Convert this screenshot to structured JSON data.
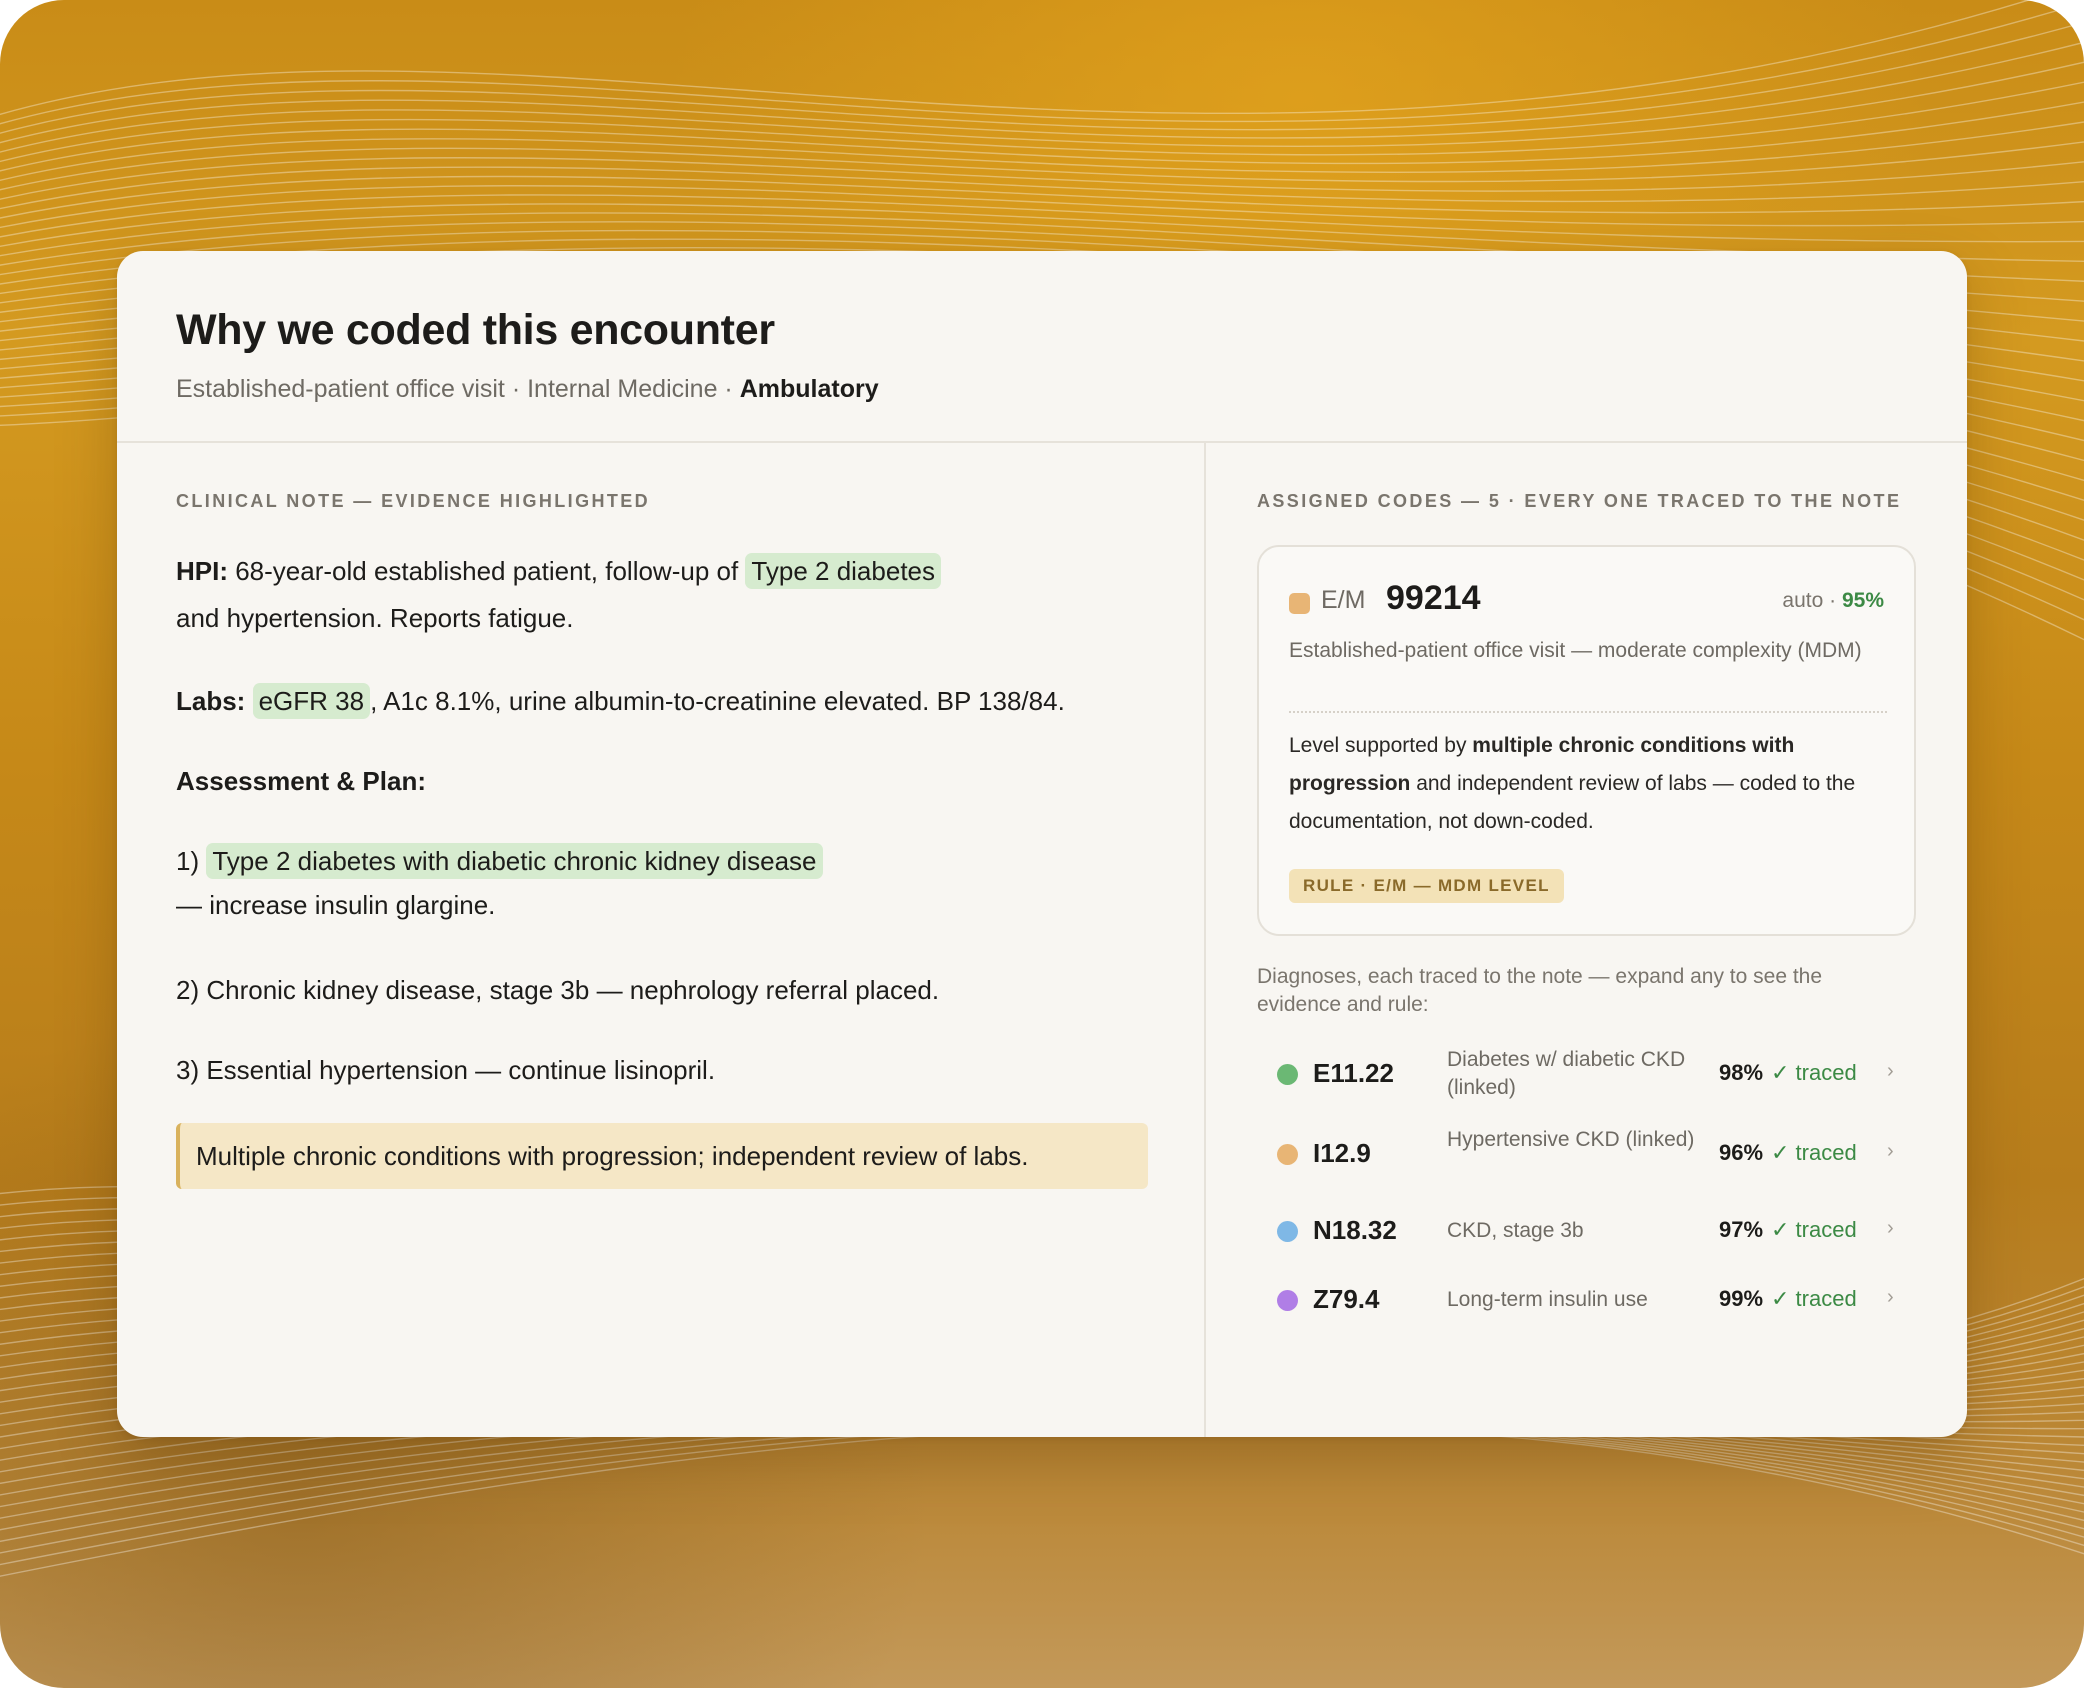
{
  "header": {
    "title": "Why we coded this encounter",
    "subtitle_prefix": "Established-patient office visit · Internal Medicine · ",
    "subtitle_bold": "Ambulatory"
  },
  "note": {
    "section_label": "CLINICAL NOTE — EVIDENCE HIGHLIGHTED",
    "hpi_label": "HPI:",
    "hpi_text": " 68-year-old established patient, follow-up of ",
    "hpi_highlight": "Type 2 diabetes",
    "hpi_cont": " and hypertension. Reports fatigue.",
    "labs_label": "Labs:",
    "labs_highlight": "eGFR 38",
    "labs_text": ", A1c 8.1%, urine albumin-to-creatinine elevated. BP 138/84.",
    "assessment_label": "Assessment & Plan:",
    "item1_num": "1)",
    "item1_highlight": "Type 2 diabetes with diabetic chronic kidney disease",
    "item1_cont": " — increase insulin glargine.",
    "item2": "2) Chronic kidney disease, stage 3b — nephrology referral placed.",
    "item3": "3) Essential hypertension — continue lisinopril.",
    "callout": "Multiple chronic conditions with progression; independent review of labs."
  },
  "codes": {
    "section_label": "ASSIGNED CODES — 5 · EVERY ONE TRACED TO THE NOTE",
    "em": {
      "type": "E/M",
      "code": "99214",
      "auto": "auto · ",
      "confidence": "95%",
      "description": "Established-patient office visit — moderate complexity (MDM)",
      "support_pre": "Level supported by ",
      "support_bold": "multiple chronic conditions with progression",
      "support_post": " and independent review of labs — coded to the documentation, not down-coded.",
      "rule": "RULE · E/M — MDM LEVEL",
      "color": "#e8b575"
    },
    "dx_intro": "Diagnoses, each traced to the note — expand any to see the evidence and rule:",
    "diagnoses": [
      {
        "code": "E11.22",
        "desc": "Diabetes w/ diabetic CKD (linked)",
        "pct": "98%",
        "status": "✓ traced",
        "color": "#6bb874"
      },
      {
        "code": "I12.9",
        "desc": "Hypertensive CKD (linked)",
        "pct": "96%",
        "status": "✓ traced",
        "color": "#e8b575"
      },
      {
        "code": "N18.32",
        "desc": "CKD, stage 3b",
        "pct": "97%",
        "status": "✓ traced",
        "color": "#7fb8e6"
      },
      {
        "code": "Z79.4",
        "desc": "Long-term insulin use",
        "pct": "99%",
        "status": "✓ traced",
        "color": "#b07ee6"
      }
    ],
    "chevron": "›"
  }
}
